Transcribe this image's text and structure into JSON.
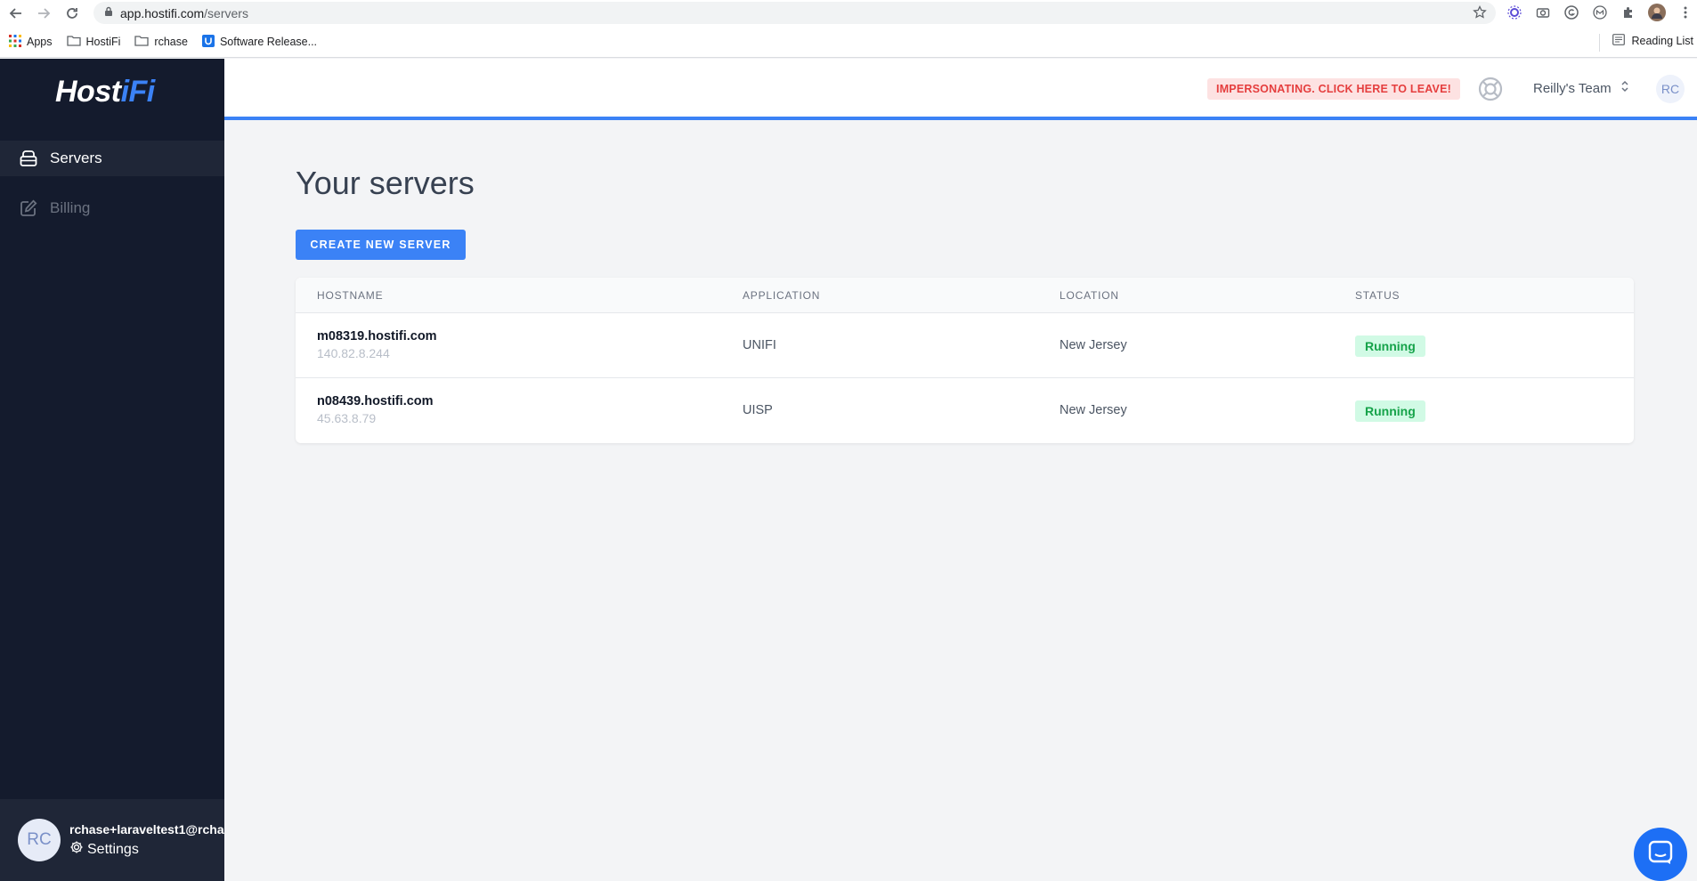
{
  "browser": {
    "url_host": "app.hostifi.com",
    "url_path": "/servers",
    "bookmarks": [
      {
        "label": "Apps",
        "icon": "apps-grid-icon"
      },
      {
        "label": "HostiFi",
        "icon": "folder-icon"
      },
      {
        "label": "rchase",
        "icon": "folder-icon"
      },
      {
        "label": "Software Release...",
        "icon": "ubiquiti-icon"
      }
    ],
    "reading_list": "Reading List"
  },
  "sidebar": {
    "logo_host": "Host",
    "logo_fi": "iFi",
    "items": [
      {
        "label": "Servers",
        "icon": "server-icon",
        "active": true
      },
      {
        "label": "Billing",
        "icon": "edit-icon",
        "active": false
      }
    ],
    "user": {
      "initials": "RC",
      "email": "rchase+laraveltest1@rcha",
      "settings_label": "Settings"
    }
  },
  "header": {
    "impersonate_label": "IMPERSONATING. CLICK HERE TO LEAVE!",
    "team_name": "Reilly's Team",
    "avatar_initials": "RC"
  },
  "main": {
    "title": "Your servers",
    "create_button": "CREATE NEW SERVER",
    "table": {
      "headers": [
        "HOSTNAME",
        "APPLICATION",
        "LOCATION",
        "STATUS"
      ],
      "rows": [
        {
          "hostname": "m08319.hostifi.com",
          "ip": "140.82.8.244",
          "application": "UNIFI",
          "location": "New Jersey",
          "status": "Running"
        },
        {
          "hostname": "n08439.hostifi.com",
          "ip": "45.63.8.79",
          "application": "UISP",
          "location": "New Jersey",
          "status": "Running"
        }
      ]
    }
  },
  "colors": {
    "accent": "#3b82f6",
    "sidebar_bg": "#141b2d",
    "running_bg": "#d1fae5",
    "running_text": "#16a34a",
    "impersonate_bg": "#fde2e2",
    "impersonate_text": "#e53e3e"
  }
}
